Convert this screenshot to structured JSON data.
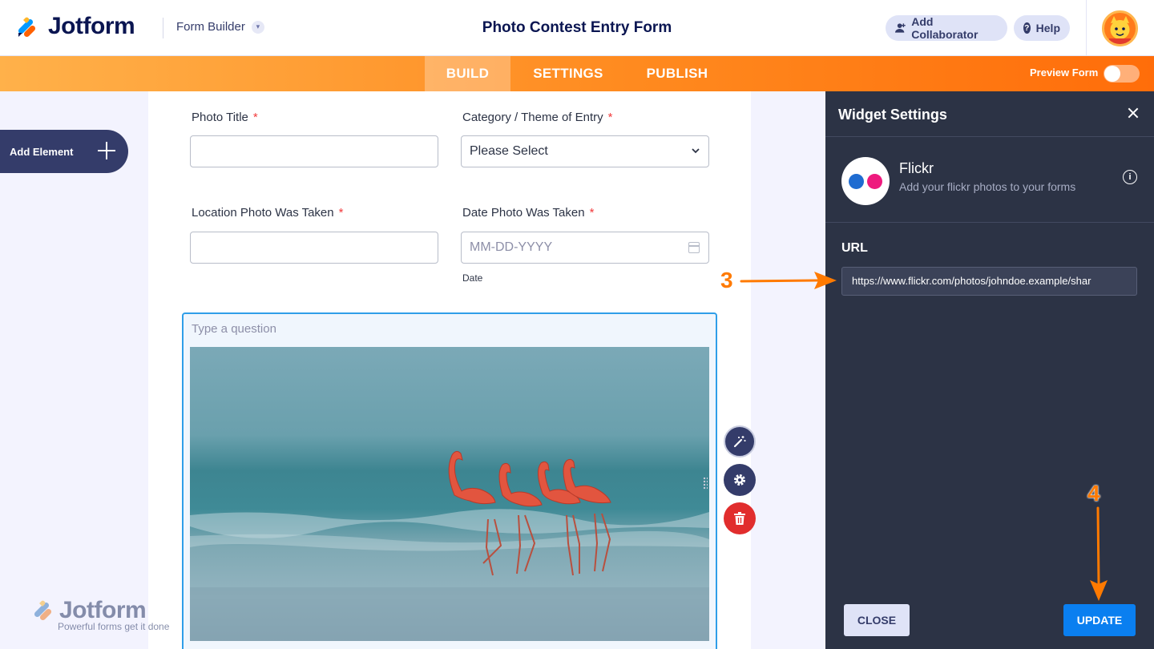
{
  "header": {
    "brand": "Jotform",
    "mode_label": "Form Builder",
    "form_title": "Photo Contest Entry Form",
    "add_collaborator_label": "Add Collaborator",
    "help_label": "Help"
  },
  "nav": {
    "tabs": [
      {
        "label": "BUILD",
        "active": true
      },
      {
        "label": "SETTINGS",
        "active": false
      },
      {
        "label": "PUBLISH",
        "active": false
      }
    ],
    "preview_label": "Preview Form",
    "preview_on": false
  },
  "sidebar": {
    "add_element_label": "Add Element"
  },
  "form": {
    "photo_title": {
      "label": "Photo Title",
      "required": "*",
      "value": ""
    },
    "category": {
      "label": "Category / Theme of Entry",
      "required": "*",
      "value": "Please Select"
    },
    "location": {
      "label": "Location Photo Was Taken",
      "required": "*",
      "value": ""
    },
    "date": {
      "label": "Date Photo Was Taken",
      "required": "*",
      "placeholder": "MM-DD-YYYY",
      "sublabel": "Date"
    },
    "widget_question_placeholder": "Type a question"
  },
  "watermark": {
    "brand": "Jotform",
    "tagline": "Powerful forms get it done"
  },
  "panel": {
    "title": "Widget Settings",
    "widget_name": "Flickr",
    "widget_description": "Add your flickr photos to your forms",
    "url_label": "URL",
    "url_value": "https://www.flickr.com/photos/johndoe.example/shar",
    "close_button": "CLOSE",
    "update_button": "UPDATE"
  },
  "annotations": {
    "step_url": "3",
    "step_update": "4"
  },
  "colors": {
    "brand_navy": "#0a1551",
    "nav_orange": "#ff8a1f",
    "panel_bg": "#2c3345",
    "update_blue": "#0a7ff0",
    "annotation_orange": "#ff7a00",
    "required_red": "#f23a3c"
  }
}
